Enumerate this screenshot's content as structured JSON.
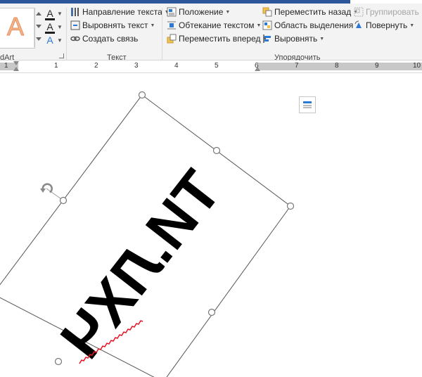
{
  "ribbon": {
    "wordart_group_label": "dArt",
    "text_group": {
      "label": "Текст",
      "direction": "Направление текста",
      "align": "Выровнять текст",
      "link": "Создать связь"
    },
    "arrange_group": {
      "label": "Упорядочить",
      "position": "Положение",
      "wrap": "Обтекание текстом",
      "bring_forward": "Переместить вперед",
      "send_backward": "Переместить назад",
      "selection_pane": "Область выделения",
      "align": "Выровнять",
      "group": "Группировать",
      "rotate": "Повернуть"
    },
    "text_fill_color": "#1f1f1f",
    "text_outline_color": "#1f1f1f",
    "text_effect_color": "#2b79d7",
    "wordart_preview_letter": "A"
  },
  "ruler": {
    "numbers": [
      "1",
      "1",
      "2",
      "3",
      "4",
      "5",
      "6",
      "7",
      "8",
      "9",
      "10"
    ]
  },
  "document": {
    "wordart_text": "ТИ.ЛХЧ",
    "spelling_underline_color": "#e81123"
  },
  "colors": {
    "title_bar": "#2b579a",
    "ribbon_bg": "#f3f3f3",
    "selection_handle": "#8a8a8a"
  }
}
